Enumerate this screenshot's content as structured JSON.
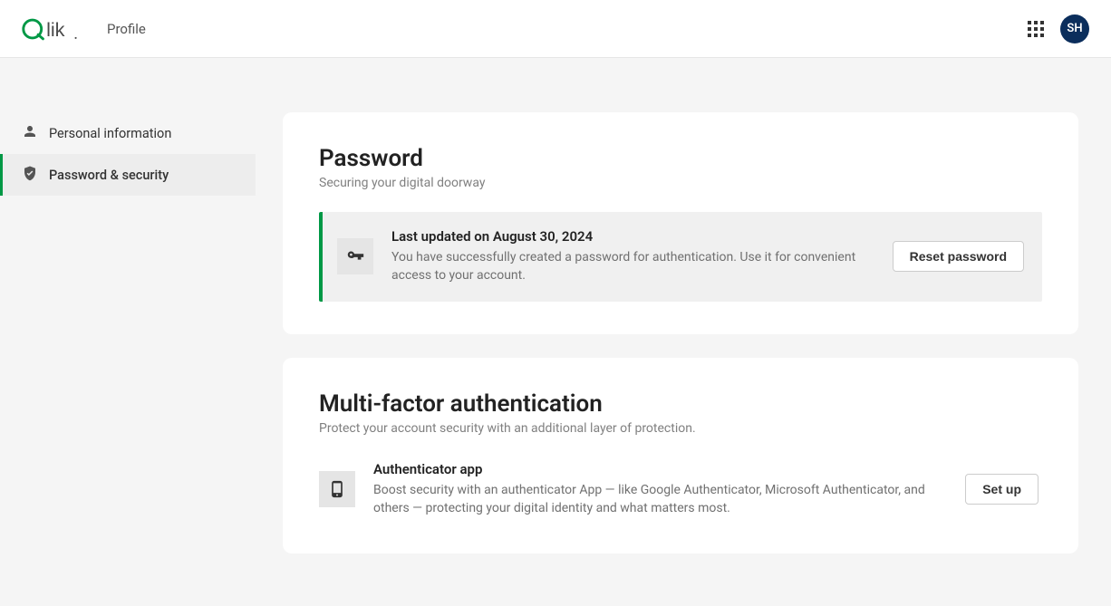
{
  "header": {
    "page_label": "Profile",
    "avatar_initials": "SH"
  },
  "sidebar": {
    "items": [
      {
        "label": "Personal information"
      },
      {
        "label": "Password & security"
      }
    ]
  },
  "password": {
    "title": "Password",
    "subtitle": "Securing your digital doorway",
    "info_title": "Last updated on August 30, 2024",
    "info_desc": "You have successfully created a password for authentication. Use it for convenient access to your account.",
    "reset_button": "Reset password"
  },
  "mfa": {
    "title": "Multi-factor authentication",
    "subtitle": "Protect your account security with an additional layer of protection.",
    "auth_title": "Authenticator app",
    "auth_desc": "Boost security with an authenticator App — like Google Authenticator, Microsoft Authenticator, and others — protecting your digital identity and what matters most.",
    "setup_button": "Set up"
  }
}
